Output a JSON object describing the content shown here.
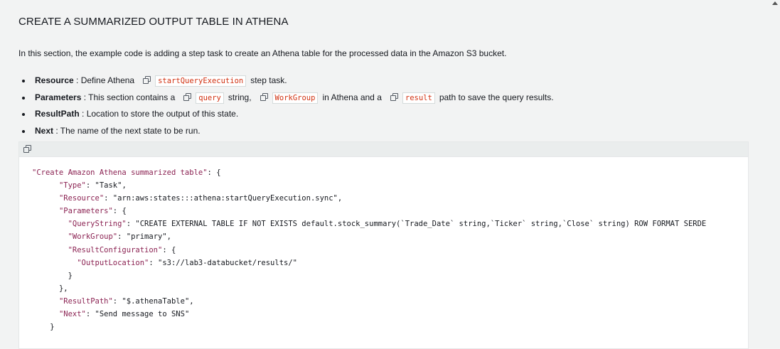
{
  "section": {
    "heading": "CREATE A SUMMARIZED OUTPUT TABLE IN ATHENA",
    "intro": "In this section, the example code is adding a step task to create an Athena table for the processed data in the Amazon S3 bucket."
  },
  "bullets": [
    {
      "term": "Resource",
      "sep": " : Define Athena",
      "code": "startQueryExecution",
      "after": "step task."
    },
    {
      "term": "Parameters",
      "sep": " : This section contains a",
      "code": "query",
      "mid1": "string,",
      "code2": "WorkGroup",
      "mid2": "in Athena and a",
      "code3": "result",
      "after": "path to save the query results."
    },
    {
      "term": "ResultPath",
      "sep": " : Location to store the output of this state."
    },
    {
      "term": "Next",
      "sep": " : The name of the next state to be run."
    }
  ],
  "code_lines": [
    {
      "indent": "",
      "key": "\"Create Amazon Athena summarized table\"",
      "rest": ": {"
    },
    {
      "indent": "      ",
      "key": "\"Type\"",
      "rest": ": \"Task\","
    },
    {
      "indent": "      ",
      "key": "\"Resource\"",
      "rest": ": \"arn:aws:states:::athena:startQueryExecution.sync\","
    },
    {
      "indent": "      ",
      "key": "\"Parameters\"",
      "rest": ": {"
    },
    {
      "indent": "        ",
      "key": "\"QueryString\"",
      "rest": ": \"CREATE EXTERNAL TABLE IF NOT EXISTS default.stock_summary(`Trade_Date` string,`Ticker` string,`Close` string) ROW FORMAT SERDE"
    },
    {
      "indent": "        ",
      "key": "\"WorkGroup\"",
      "rest": ": \"primary\","
    },
    {
      "indent": "        ",
      "key": "\"ResultConfiguration\"",
      "rest": ": {"
    },
    {
      "indent": "          ",
      "key": "\"OutputLocation\"",
      "rest": ": \"s3://lab3-databucket/results/\""
    },
    {
      "indent": "        ",
      "key": "",
      "rest": "}"
    },
    {
      "indent": "      ",
      "key": "",
      "rest": "},"
    },
    {
      "indent": "      ",
      "key": "\"ResultPath\"",
      "rest": ": \"$.athenaTable\","
    },
    {
      "indent": "      ",
      "key": "\"Next\"",
      "rest": ": \"Send message to SNS\""
    },
    {
      "indent": "    ",
      "key": "",
      "rest": "}"
    }
  ]
}
